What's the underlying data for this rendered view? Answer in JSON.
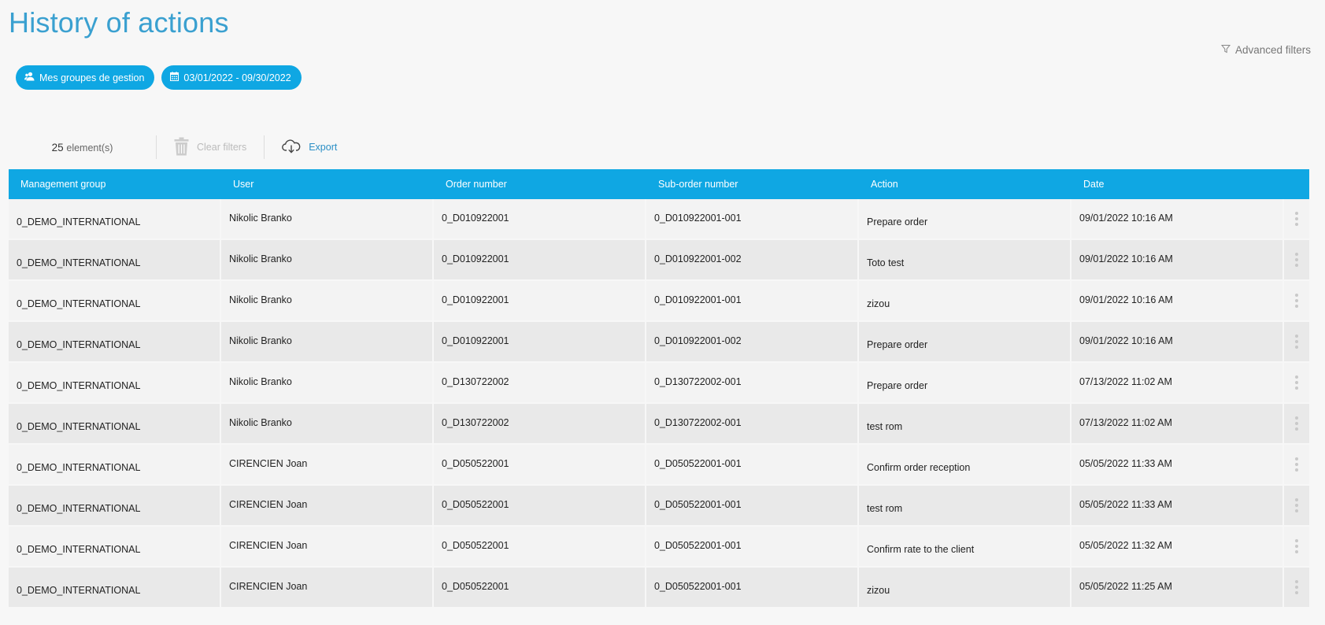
{
  "header": {
    "title": "History of actions",
    "advanced_filters": "Advanced filters"
  },
  "chips": {
    "groups": "Mes groupes de gestion",
    "date_range": "03/01/2022 - 09/30/2022"
  },
  "toolbar": {
    "count": "25",
    "count_unit": "element(s)",
    "clear_filters": "Clear filters",
    "export": "Export"
  },
  "table": {
    "columns": [
      "Management group",
      "User",
      "Order number",
      "Sub-order number",
      "Action",
      "Date"
    ],
    "rows": [
      [
        "0_DEMO_INTERNATIONAL",
        "Nikolic Branko",
        "0_D010922001",
        "0_D010922001-001",
        "Prepare order",
        "09/01/2022 10:16 AM"
      ],
      [
        "0_DEMO_INTERNATIONAL",
        "Nikolic Branko",
        "0_D010922001",
        "0_D010922001-002",
        "Toto test",
        "09/01/2022 10:16 AM"
      ],
      [
        "0_DEMO_INTERNATIONAL",
        "Nikolic Branko",
        "0_D010922001",
        "0_D010922001-001",
        "zizou",
        "09/01/2022 10:16 AM"
      ],
      [
        "0_DEMO_INTERNATIONAL",
        "Nikolic Branko",
        "0_D010922001",
        "0_D010922001-002",
        "Prepare order",
        "09/01/2022 10:16 AM"
      ],
      [
        "0_DEMO_INTERNATIONAL",
        "Nikolic Branko",
        "0_D130722002",
        "0_D130722002-001",
        "Prepare order",
        "07/13/2022 11:02 AM"
      ],
      [
        "0_DEMO_INTERNATIONAL",
        "Nikolic Branko",
        "0_D130722002",
        "0_D130722002-001",
        "test rom",
        "07/13/2022 11:02 AM"
      ],
      [
        "0_DEMO_INTERNATIONAL",
        "CIRENCIEN Joan",
        "0_D050522001",
        "0_D050522001-001",
        "Confirm order reception",
        "05/05/2022 11:33 AM"
      ],
      [
        "0_DEMO_INTERNATIONAL",
        "CIRENCIEN Joan",
        "0_D050522001",
        "0_D050522001-001",
        "test rom",
        "05/05/2022 11:33 AM"
      ],
      [
        "0_DEMO_INTERNATIONAL",
        "CIRENCIEN Joan",
        "0_D050522001",
        "0_D050522001-001",
        "Confirm rate to the client",
        "05/05/2022 11:32 AM"
      ],
      [
        "0_DEMO_INTERNATIONAL",
        "CIRENCIEN Joan",
        "0_D050522001",
        "0_D050522001-001",
        "zizou",
        "05/05/2022 11:25 AM"
      ]
    ]
  },
  "icons": {
    "filter": "filter-icon",
    "groups": "user-group-icon",
    "calendar": "calendar-icon",
    "trash": "trash-icon",
    "export": "cloud-download-icon",
    "row_menu": "more-vertical-icon"
  },
  "colors": {
    "accent": "#0fa7e3",
    "title": "#3aa0d0",
    "link": "#2b8fc6"
  }
}
